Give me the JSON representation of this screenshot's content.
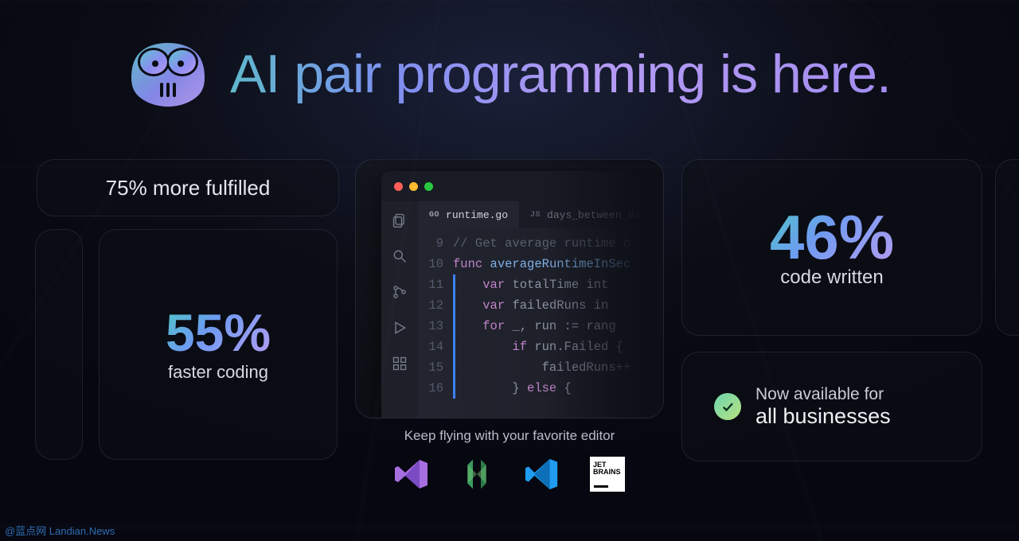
{
  "headline": "AI pair programming is here.",
  "stats": {
    "fulfilled": "75% more fulfilled",
    "faster_pct": "55%",
    "faster_label": "faster coding",
    "written_pct": "46%",
    "written_label": "code written"
  },
  "availability": {
    "line1": "Now available for",
    "line2": "all businesses"
  },
  "editor": {
    "tab_active_lang": "GO",
    "tab_active_name": "runtime.go",
    "tab_inactive_lang": "JS",
    "tab_inactive_name": "days_between_da",
    "line_start": 9,
    "lines": [
      {
        "n": 9,
        "html": "<span class='cm'>// Get average runtime o</span>"
      },
      {
        "n": 10,
        "html": "<span class='kw'>func</span> <span class='fn'>averageRuntimeInSec</span>"
      },
      {
        "n": 11,
        "html": "    <span class='kw'>var</span> <span class='vr'>totalTime</span> int"
      },
      {
        "n": 12,
        "html": "    <span class='kw'>var</span> <span class='vr'>failedRuns</span> in"
      },
      {
        "n": 13,
        "html": "    <span class='kw'>for</span> _, run := rang"
      },
      {
        "n": 14,
        "html": "        <span class='kw'>if</span> run.Failed {"
      },
      {
        "n": 15,
        "html": "            failedRuns++"
      },
      {
        "n": 16,
        "html": "        } <span class='kw'>else</span> {"
      }
    ]
  },
  "editors_caption": "Keep flying with your favorite editor",
  "editors": [
    "visual-studio",
    "neovim",
    "vscode",
    "jetbrains"
  ],
  "jetbrains_label": "JET\nBRAINS",
  "watermark": "@蓝点网  Landian.News"
}
